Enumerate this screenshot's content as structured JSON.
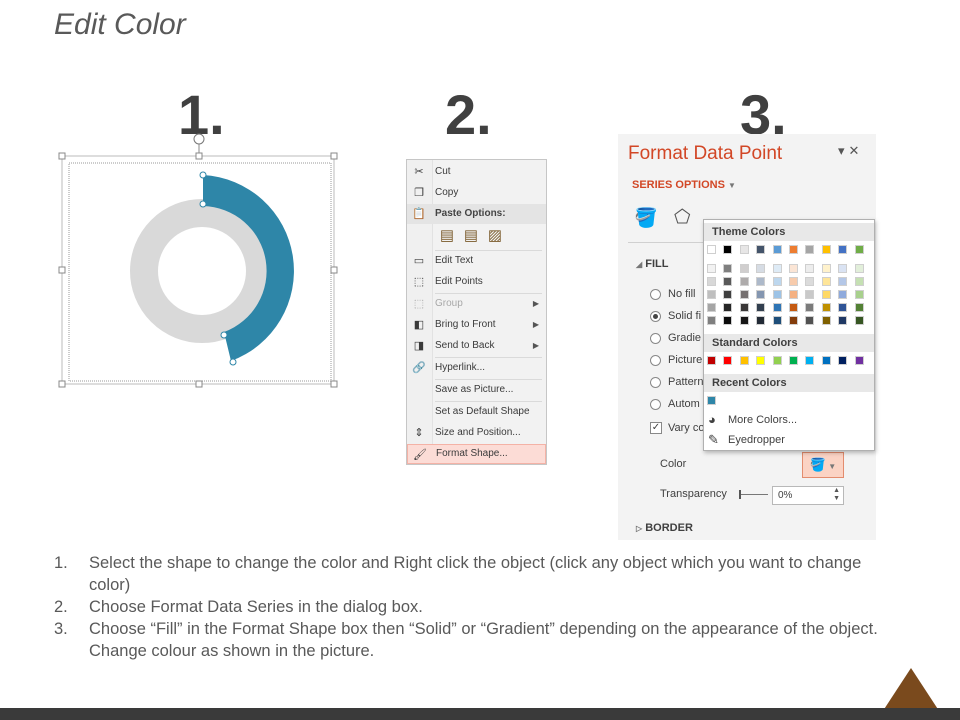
{
  "title": "Edit Color",
  "steps_numbers": [
    "1.",
    "2.",
    "3."
  ],
  "context_menu": {
    "items": [
      {
        "label": "Cut",
        "icon": "scissors-icon"
      },
      {
        "label": "Copy",
        "icon": "copy-icon"
      },
      {
        "label": "Paste Options:",
        "icon": "paste-icon"
      },
      {
        "label": "Edit Text",
        "icon": "edit-text-icon"
      },
      {
        "label": "Edit Points",
        "icon": "edit-points-icon"
      },
      {
        "label": "Group",
        "icon": "group-icon"
      },
      {
        "label": "Bring to Front",
        "icon": "bring-front-icon"
      },
      {
        "label": "Send to Back",
        "icon": "send-back-icon"
      },
      {
        "label": "Hyperlink...",
        "icon": "hyperlink-icon"
      },
      {
        "label": "Save as Picture...",
        "icon": ""
      },
      {
        "label": "Set as Default Shape",
        "icon": ""
      },
      {
        "label": "Size and Position...",
        "icon": "size-position-icon"
      },
      {
        "label": "Format Shape...",
        "icon": "format-shape-icon"
      }
    ]
  },
  "format_pane": {
    "title": "Format Data Point",
    "series_options": "SERIES OPTIONS",
    "fill_header": "FILL",
    "options": [
      "No fill",
      "Solid fi",
      "Gradie",
      "Picture",
      "Pattern",
      "Autom",
      "Vary co"
    ],
    "color_label": "Color",
    "transparency_label": "Transparency",
    "transparency_value": "0%",
    "border_header": "BORDER"
  },
  "color_picker": {
    "theme_colors_label": "Theme Colors",
    "standard_colors_label": "Standard Colors",
    "recent_colors_label": "Recent Colors",
    "more_colors": "More Colors...",
    "eyedropper": "Eyedropper",
    "theme_top": [
      "#ffffff",
      "#000000",
      "#e7e6e6",
      "#44546a",
      "#5b9bd5",
      "#ed7d31",
      "#a5a5a5",
      "#ffc000",
      "#4472c4",
      "#70ad47"
    ],
    "theme_shades": [
      [
        "#f2f2f2",
        "#7f7f7f",
        "#d0cece",
        "#d6dce4",
        "#deebf6",
        "#fbe5d5",
        "#ededed",
        "#fff2cc",
        "#dae3f3",
        "#e2efda"
      ],
      [
        "#d8d8d8",
        "#595959",
        "#aeabab",
        "#adb9ca",
        "#bdd7ee",
        "#f7cbac",
        "#dbdbdb",
        "#fee599",
        "#b4c7e7",
        "#c5e0b3"
      ],
      [
        "#bfbfbf",
        "#3f3f3f",
        "#757070",
        "#8496b0",
        "#9dc3e6",
        "#f4b183",
        "#c9c9c9",
        "#ffd966",
        "#8faadc",
        "#a8d08d"
      ],
      [
        "#a5a5a5",
        "#262626",
        "#3a3838",
        "#323f4f",
        "#2e75b5",
        "#c55a11",
        "#7b7b7b",
        "#bf9000",
        "#2f5496",
        "#538135"
      ],
      [
        "#7f7f7f",
        "#0c0c0c",
        "#171616",
        "#222a35",
        "#1e4e79",
        "#833c0b",
        "#525252",
        "#7f6000",
        "#1f3864",
        "#375623"
      ]
    ],
    "standard": [
      "#c00000",
      "#ff0000",
      "#ffc000",
      "#ffff00",
      "#92d050",
      "#00b050",
      "#00b0f0",
      "#0070c0",
      "#002060",
      "#7030a0"
    ],
    "recent": [
      "#2e86a8"
    ]
  },
  "doughnut": {
    "accent_color": "#2e86a8",
    "base_color": "#d9d9d9"
  },
  "instructions": [
    {
      "num": "1.",
      "text": "Select the shape to change the color and Right click the object (click any object which you want to change color)"
    },
    {
      "num": "2.",
      "text": "Choose Format Data Series in the dialog box."
    },
    {
      "num": "3.",
      "text": "Choose “Fill” in the Format Shape box then “Solid” or “Gradient” depending on the appearance of the object. Change colour as shown in the picture."
    }
  ]
}
